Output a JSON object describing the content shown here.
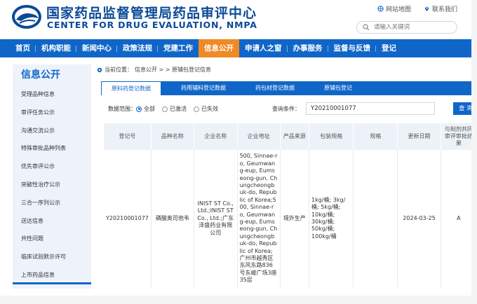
{
  "header": {
    "title_cn": "国家药品监督管理局药品审评中心",
    "title_en": "CENTER FOR DRUG EVALUATION, NMPA",
    "links": [
      {
        "label": "网站地图",
        "icon": "sitemap-icon"
      },
      {
        "label": "联系我们",
        "icon": "pin-icon"
      }
    ],
    "search_placeholder": "请输入关键词"
  },
  "nav": {
    "items": [
      "首页",
      "机构职能",
      "新闻中心",
      "政策法规",
      "党建工作",
      "信息公开",
      "申请人之窗",
      "办事服务",
      "监督与反馈",
      "登记"
    ],
    "active": "信息公开"
  },
  "sidebar": {
    "title": "信息公开",
    "items": [
      "受理品种信息",
      "审评任务公示",
      "沟通交流公示",
      "特殊审批品种列表",
      "优先审评公示",
      "突破性治疗公示",
      "三合一序列公示",
      "送达信息",
      "共性问题",
      "临床试验默示许可",
      "上市药品信息"
    ]
  },
  "breadcrumb": {
    "prefix": "当前位置：",
    "path": "信息公开 > > 原辅包登记信息"
  },
  "tabs": [
    "原料药登记数据",
    "药用辅料登记数据",
    "药包材登记数据",
    "原辅包登记"
  ],
  "filter": {
    "label": "数据范围：",
    "options": [
      "全部",
      "已激活",
      "已失效"
    ],
    "selected": "全部",
    "query_label": "查询条件：",
    "query_value": "Y20210001077",
    "query_button": "查 询"
  },
  "table": {
    "headers": [
      "登记号",
      "品种名称",
      "企业名称",
      "企业地址",
      "产品来源",
      "包装规格",
      "规格",
      "更新日期",
      "与制剂共同审评审批结果"
    ],
    "rows": [
      {
        "reg_no": "Y20210001077",
        "name": "磷酸奥司他韦",
        "enterprise": "INIST ST Co., Ltd.;INIST ST Co., Ltd.;广东泽盛药业有限公司",
        "address": "500, Sinnae-ro, Geumwang-eup, Eumseong-gun, Chungcheongbuk-do, Republic of Korea;500, Sinnae-ro, Geumwang-eup, Eumseong-gun, Chungcheongbuk-do, Republic of Korea;广州市越秀区东风东路836号东峻广场3座35层",
        "source": "境外生产",
        "package": "1kg/桶; 3kg/桶; 5kg/桶; 10kg/桶; 30kg/桶; 50kg/桶; 100kg/桶",
        "spec": "",
        "date": "2024-03-25",
        "result": "A"
      }
    ]
  },
  "colors": {
    "brand_blue": "#1066c8",
    "active_orange": "#f08a24",
    "title_blue": "#0b4a97"
  }
}
